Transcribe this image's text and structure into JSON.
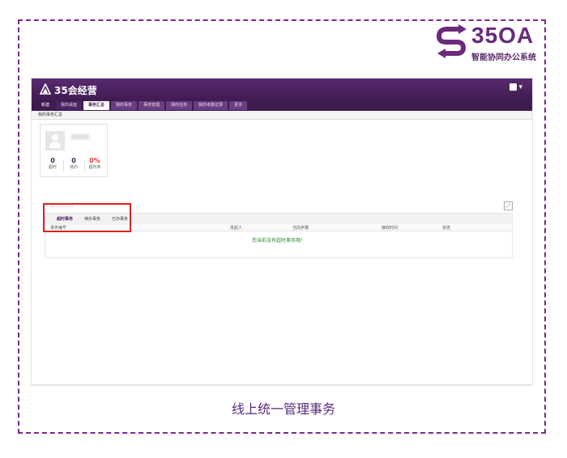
{
  "brand": {
    "name": "35OA",
    "subtitle": "智能协同办公系统",
    "color": "#6a2a7c"
  },
  "app": {
    "title": "35会经营",
    "nav": [
      {
        "label": "新建",
        "kind": "new"
      },
      {
        "label": "我的桌面",
        "kind": "plain"
      },
      {
        "label": "事务汇总",
        "kind": "active"
      },
      {
        "label": "我的事务",
        "kind": "normal"
      },
      {
        "label": "事务管理",
        "kind": "normal"
      },
      {
        "label": "我的任务",
        "kind": "normal"
      },
      {
        "label": "我的考勤记录",
        "kind": "normal"
      },
      {
        "label": "更多",
        "kind": "normal"
      }
    ],
    "subnav_label": "我的事务汇总",
    "stats": [
      {
        "value": "0",
        "label": "超时",
        "highlight": false
      },
      {
        "value": "0",
        "label": "待办",
        "highlight": false
      },
      {
        "value": "0%",
        "label": "超时率",
        "highlight": true
      }
    ],
    "tabs": [
      {
        "label": "超时事务",
        "active": true
      },
      {
        "label": "待办事务",
        "active": false
      },
      {
        "label": "已办事务",
        "active": false
      }
    ],
    "columns": [
      "事务编号",
      "发起人",
      "当前步骤",
      "接收时间",
      "状态"
    ],
    "empty_message": "您当前没有超时事务哦！"
  },
  "caption": "线上统一管理事务",
  "colors": {
    "accent": "#4a2060",
    "highlight_box": "#e02020",
    "empty_text": "#2e8b2e"
  }
}
